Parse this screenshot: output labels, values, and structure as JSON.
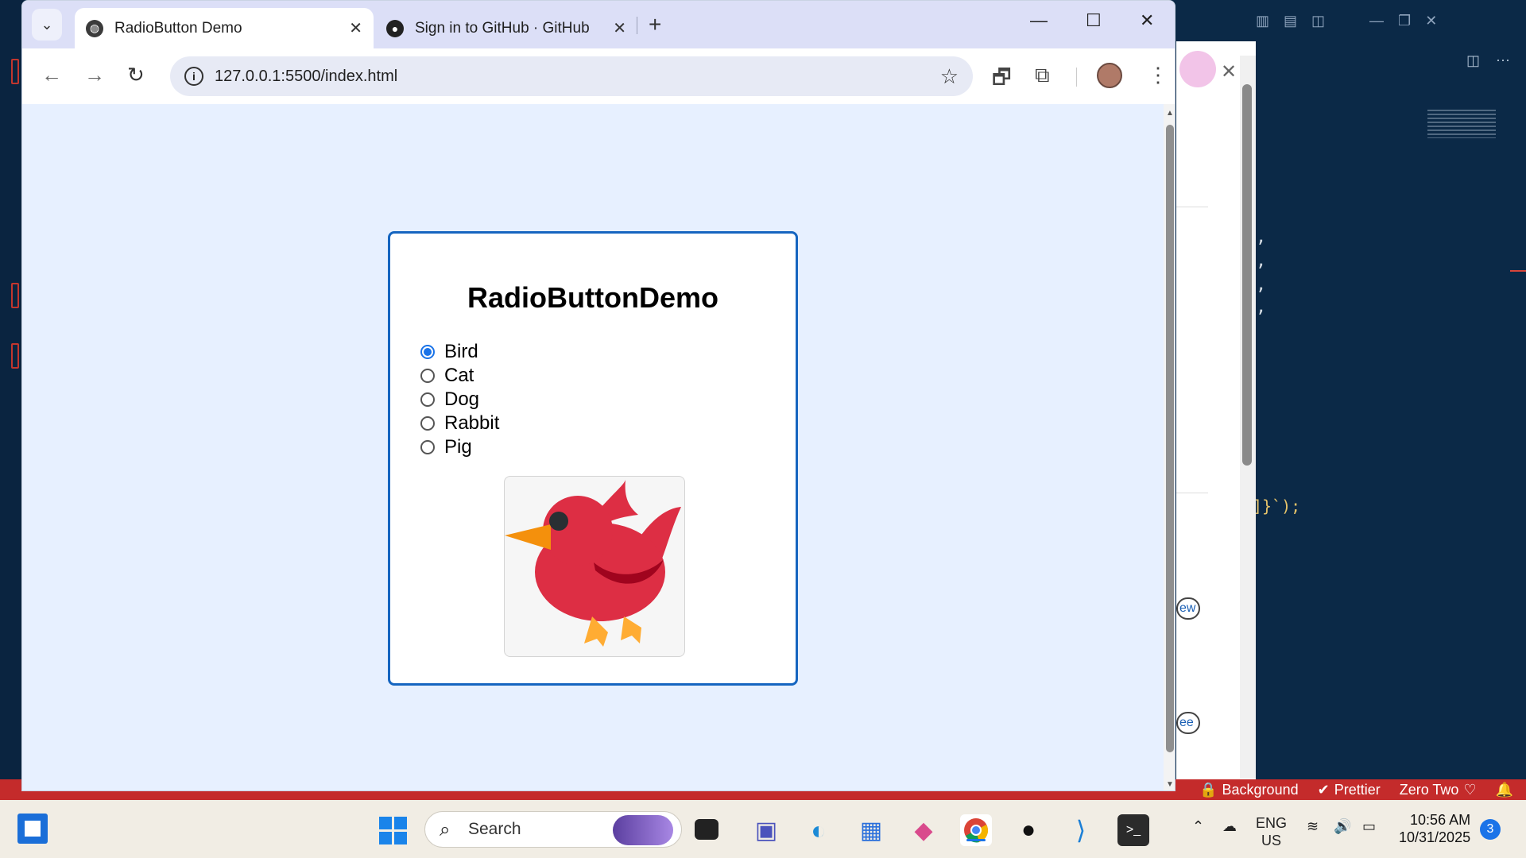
{
  "browser": {
    "tabs": [
      {
        "title": "RadioButton Demo",
        "active": true
      },
      {
        "title": "Sign in to GitHub · GitHub",
        "active": false
      }
    ],
    "address": "127.0.0.1:5500/index.html"
  },
  "page": {
    "heading": "RadioButtonDemo",
    "options": [
      "Bird",
      "Cat",
      "Dog",
      "Rabbit",
      "Pig"
    ],
    "selected": "Bird",
    "image_icon": "bird-emoji-icon"
  },
  "vscode": {
    "status_items": [
      "Background",
      "Prettier",
      "Zero Two"
    ],
    "code_line": "]}`);",
    "side_pills": [
      "ew",
      "ee"
    ]
  },
  "taskbar": {
    "search_placeholder": "Search",
    "language": "ENG",
    "region": "US",
    "time": "10:56 AM",
    "date": "10/31/2025",
    "notification_count": "3"
  },
  "colors": {
    "accent": "#1a73e8",
    "card_border": "#1565c0",
    "page_bg": "#e7f0ff",
    "vscode_status": "#c42b2b"
  }
}
